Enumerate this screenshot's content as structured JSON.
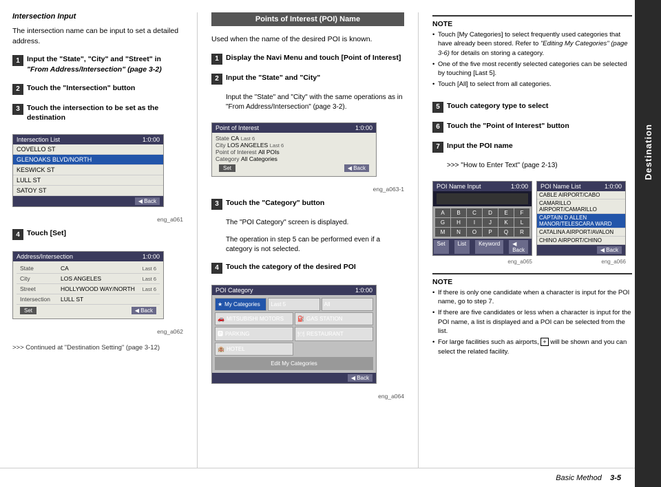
{
  "sidebar": {
    "label": "Destination"
  },
  "left_col": {
    "section_title": "Intersection Input",
    "section_body": "The intersection name can be input to set a detailed address.",
    "steps": [
      {
        "num": "1",
        "text": "Input the \"State\", \"City\" and \"Street\" in \"From Address/Intersection\" (page 3-2)"
      },
      {
        "num": "2",
        "text": "Touch the \"Intersection\" button"
      },
      {
        "num": "3",
        "text": "Touch the intersection to be set as the destination"
      },
      {
        "num": "4",
        "text": "Touch [Set]"
      }
    ],
    "continued_text": ">>> Continued at \"Destination Setting\" (page 3-12)",
    "intersection_screen": {
      "title": "Intersection List",
      "time": "1:0:00",
      "items": [
        "COVELLO ST",
        "GLENOAKS BLVD/NORTH",
        "KESWICK ST",
        "LULL ST",
        "SATOY ST"
      ],
      "selected": "",
      "caption": "eng_a061"
    },
    "address_screen": {
      "title": "Address/Intersection",
      "time": "1:0:00",
      "fields": [
        {
          "label": "State",
          "value": "CA",
          "badge": "Last 6"
        },
        {
          "label": "City",
          "value": "LOS ANGELES",
          "badge": "Last 6"
        },
        {
          "label": "Street",
          "value": "HOLLYWOOD WAY/NORTH",
          "badge": "Last 6"
        },
        {
          "label": "Intersection",
          "value": "LULL ST",
          "badge": ""
        }
      ],
      "caption": "eng_a062"
    }
  },
  "mid_col": {
    "poi_header": "Points of Interest (POI) Name",
    "intro_text": "Used when the name of the desired POI is known.",
    "steps": [
      {
        "num": "1",
        "text": "Display the Navi Menu and touch [Point of Interest]"
      },
      {
        "num": "2",
        "text": "Input the \"State\" and \"City\"",
        "subtext": "Input the \"State\" and \"City\" with the same operations as in \"From Address/Intersection\" (page 3-2)."
      },
      {
        "num": "3",
        "text": "Touch the \"Category\" button",
        "subtext1": "The \"POI Category\" screen is displayed.",
        "subtext2": "The operation in step 5 can be performed even if a category is not selected."
      },
      {
        "num": "4",
        "text": "Touch the category of the desired POI"
      }
    ],
    "poi_screen": {
      "title": "Point of Interest",
      "time": "1:0:00",
      "fields": [
        {
          "label": "State",
          "value": "CA",
          "badge": "Last 6"
        },
        {
          "label": "City",
          "value": "LOS ANGELES",
          "badge": "Last 6"
        },
        {
          "label": "Point of Interest",
          "value": "All POIs",
          "badge": ""
        },
        {
          "label": "Category",
          "value": "All Categories",
          "badge": ""
        }
      ],
      "caption": "eng_a063-1"
    },
    "poi_cat_screen": {
      "title": "POI Category",
      "time": "1:0:00",
      "categories": [
        {
          "icon": "★",
          "label": "My Categories",
          "highlighted": true
        },
        {
          "icon": "",
          "label": "Last 5",
          "highlighted": false
        },
        {
          "icon": "",
          "label": "All",
          "highlighted": false
        },
        {
          "icon": "🚗",
          "label": "MITSUBISHI MOTORS",
          "highlighted": false
        },
        {
          "icon": "⛽",
          "label": "GAS STATION",
          "highlighted": false
        },
        {
          "icon": "P",
          "label": "PARKING",
          "highlighted": false
        },
        {
          "icon": "🍽",
          "label": "RESTAURANT",
          "highlighted": false
        },
        {
          "icon": "🏨",
          "label": "HOTEL",
          "highlighted": false
        }
      ],
      "edit_btn": "Edit My Categories",
      "caption": "eng_a064"
    }
  },
  "right_col": {
    "note1": {
      "title": "NOTE",
      "items": [
        "Touch [My Categories] to select frequently used categories that have already been stored. Refer to \"Editing My Categories\" (page 3-6) for details on storing a category.",
        "One of the five most recently selected categories can be selected by touching [Last 5].",
        "Touch [All] to select from all categories."
      ]
    },
    "steps": [
      {
        "num": "5",
        "text": "Touch category type to select"
      },
      {
        "num": "6",
        "text": "Touch the \"Point of Interest\" button"
      },
      {
        "num": "7",
        "text": "Input the POI name",
        "subtext": ">>> \"How to Enter Text\" (page 2-13)"
      }
    ],
    "poi_name_screen": {
      "title": "POI Name Input",
      "time": "1:0:00",
      "input_value": "",
      "caption": "eng_a065"
    },
    "poi_name_list_screen": {
      "title": "POI Name List",
      "time": "1:0:00",
      "items": [
        "CABLE AIRPORT/CABO",
        "CAMARILLO AIRPORT/CAMARILLO",
        "CAPTAIN D ALLEN MANOR/TELESCARA WARD",
        "CATALINA AIRPORT/AVALON",
        "CHINO AIRPORT/CHINO"
      ],
      "caption": "eng_a066"
    },
    "note2": {
      "title": "NOTE",
      "items": [
        "If there is only one candidate when a character is input for the POI name, go to step 7.",
        "If there are five candidates or less when a character is input for the POI name, a list is displayed and a POI can be selected from the list.",
        "For large facilities such as airports, [+] will be shown and you can select the related facility."
      ]
    }
  },
  "bottom": {
    "label": "Basic Method",
    "page": "3-5"
  }
}
